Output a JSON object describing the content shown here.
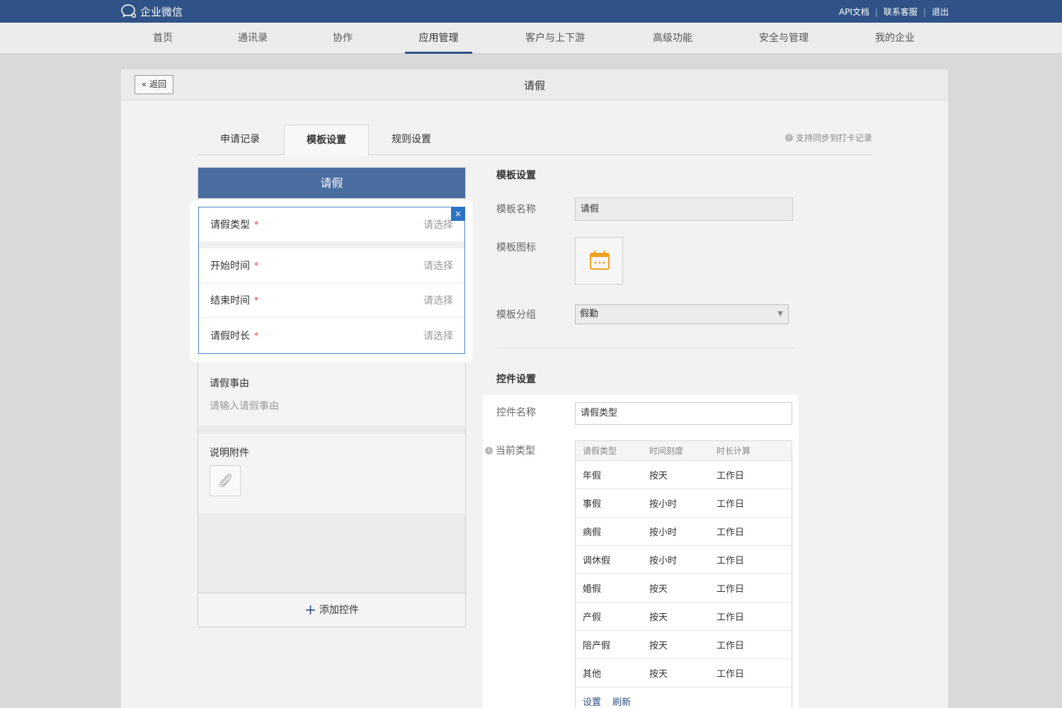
{
  "topbar": {
    "brand": "企业微信",
    "links": [
      "API文档",
      "联系客服",
      "退出"
    ]
  },
  "nav": {
    "items": [
      "首页",
      "通讯录",
      "协作",
      "应用管理",
      "客户与上下游",
      "高级功能",
      "安全与管理",
      "我的企业"
    ],
    "active": "应用管理"
  },
  "panel": {
    "back": "返回",
    "title": "请假"
  },
  "tabs": {
    "items": [
      "申请记录",
      "模板设置",
      "规则设置"
    ],
    "active": "模板设置",
    "note": "支持同步到打卡记录"
  },
  "preview": {
    "header": "请假",
    "fields": [
      {
        "label": "请假类型",
        "placeholder": "请选择"
      },
      {
        "label": "开始时间",
        "placeholder": "请选择"
      },
      {
        "label": "结束时间",
        "placeholder": "请选择"
      },
      {
        "label": "请假时长",
        "placeholder": "请选择"
      }
    ],
    "required_mark": "*",
    "reason_label": "请假事由",
    "reason_placeholder": "请输入请假事由",
    "attachment_label": "说明附件",
    "add_control": "添加控件"
  },
  "template": {
    "section_title": "模板设置",
    "name_label": "模板名称",
    "name_value": "请假",
    "icon_label": "模板图标",
    "icon": "calendar-icon",
    "icon_color": "#f0a21f",
    "group_label": "模板分组",
    "group_value": "假勤"
  },
  "control": {
    "section_title": "控件设置",
    "name_label": "控件名称",
    "name_value": "请假类型",
    "type_label": "当前类型",
    "columns": [
      "请假类型",
      "时间刻度",
      "时长计算"
    ],
    "rows": [
      [
        "年假",
        "按天",
        "工作日"
      ],
      [
        "事假",
        "按小时",
        "工作日"
      ],
      [
        "病假",
        "按小时",
        "工作日"
      ],
      [
        "调休假",
        "按小时",
        "工作日"
      ],
      [
        "婚假",
        "按天",
        "工作日"
      ],
      [
        "产假",
        "按天",
        "工作日"
      ],
      [
        "陪产假",
        "按天",
        "工作日"
      ],
      [
        "其他",
        "按天",
        "工作日"
      ]
    ],
    "actions": [
      "设置",
      "刷新"
    ]
  },
  "colors": {
    "topbar": "#2f5386",
    "accent": "#2f73c6",
    "required": "#ee3333"
  }
}
